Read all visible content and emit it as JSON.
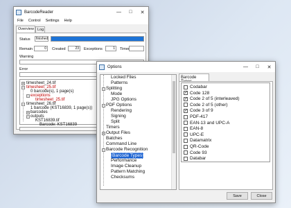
{
  "main_window": {
    "title": "BarcodeReader",
    "controls": [
      "—",
      "□",
      "✕"
    ],
    "menu": [
      "File",
      "Control",
      "Settings",
      "Help"
    ],
    "tabs": [
      "Overview",
      "Log"
    ],
    "status_label": "Status",
    "status_value": "finished",
    "status_progress": 1.0,
    "remain_label": "Remain",
    "remain_value": "0",
    "created_label": "Created",
    "created_value": "23",
    "exceptions_label": "Exceptions",
    "exceptions_value": "1",
    "timer_label": "Timer",
    "warning_label": "Warning",
    "error_label": "Error",
    "tree": [
      "timesheet_24.tif",
      "timesheet_25.tif",
      "0 barcode(s), 1 page(s)",
      "exceptions",
      "timesheet_25.tif",
      "timesheet_26.tif",
      "1 barcode (KST16839, 1 page(s))",
      "barcodes",
      "outputs",
      "KST16839.tif",
      "Barcode: KST16839"
    ]
  },
  "options_window": {
    "title": "Options",
    "controls": [
      "—",
      "□",
      "✕"
    ],
    "nav": [
      "Locked Files",
      "Patterns",
      "Splitting",
      "Mode",
      "JPG Options",
      "PDF Options",
      "Rendering",
      "Signing",
      "Split",
      "Timers",
      "Output Files",
      "Batches",
      "Command Line",
      "Barcode Recognition",
      "Barcode Types",
      "Performance",
      "Image Cleanup",
      "Pattern Matching",
      "Checksums"
    ],
    "tab_label": "Barcode Types",
    "barcode_types": [
      {
        "label": "Codabar",
        "checked": false
      },
      {
        "label": "Code 128",
        "checked": true
      },
      {
        "label": "Code 2 of 5 (interleaved)",
        "checked": true
      },
      {
        "label": "Code 2 of 5 (other)",
        "checked": false
      },
      {
        "label": "Code 3 of 9",
        "checked": true
      },
      {
        "label": "PDF-417",
        "checked": false
      },
      {
        "label": "EAN-13 and UPC-A",
        "checked": false
      },
      {
        "label": "EAN-8",
        "checked": false
      },
      {
        "label": "UPC-E",
        "checked": false
      },
      {
        "label": "Datamatrix",
        "checked": false
      },
      {
        "label": "QR-Code",
        "checked": false
      },
      {
        "label": "Code 93",
        "checked": false
      },
      {
        "label": "Databar",
        "checked": false
      }
    ],
    "save_label": "Save",
    "close_label": "Close"
  }
}
